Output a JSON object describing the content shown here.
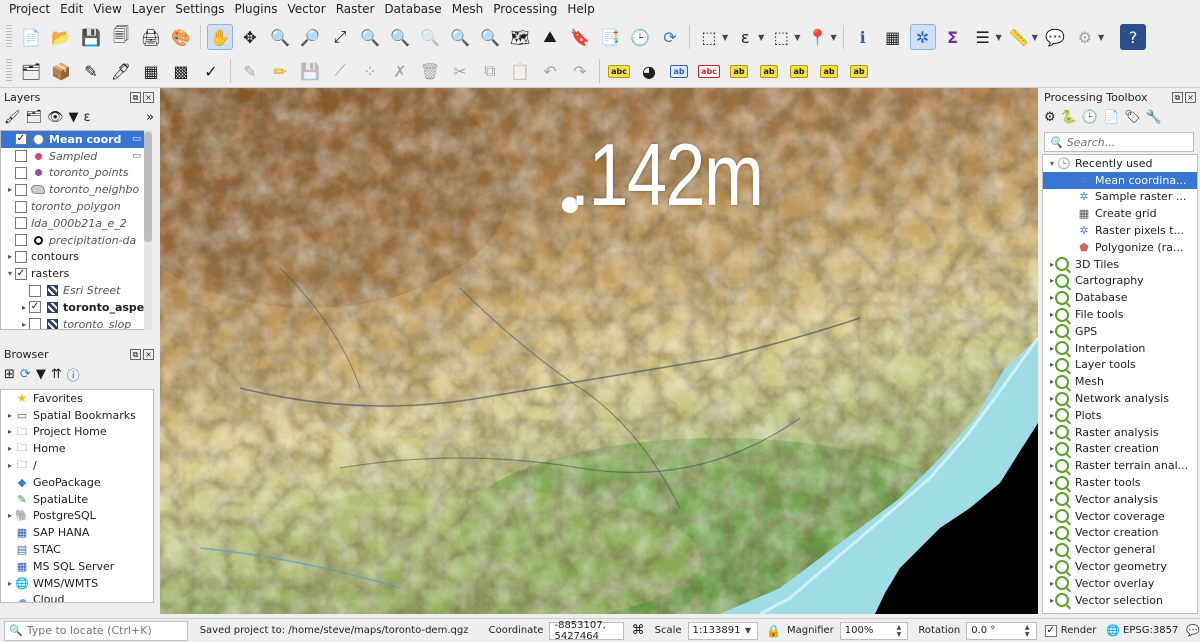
{
  "menu": [
    "Project",
    "Edit",
    "View",
    "Layer",
    "Settings",
    "Plugins",
    "Vector",
    "Raster",
    "Database",
    "Mesh",
    "Processing",
    "Help"
  ],
  "layers_panel": {
    "title": "Layers",
    "items": [
      {
        "label": "Mean coord",
        "checked": true,
        "selected": true,
        "style": "bold",
        "symbol": "circle-white-icon",
        "expander": "",
        "indent": 0
      },
      {
        "label": "Sampled",
        "checked": false,
        "style": "italic",
        "symbol": "dot-pink-icon",
        "expander": "",
        "indent": 0
      },
      {
        "label": "toronto_points",
        "checked": false,
        "style": "italic",
        "symbol": "dot-purple-icon",
        "expander": "",
        "indent": 0
      },
      {
        "label": "toronto_neighbo",
        "checked": false,
        "style": "italic",
        "symbol": "polygon-grey-icon",
        "expander": "▸",
        "indent": 0
      },
      {
        "label": "toronto_polygon",
        "checked": false,
        "style": "italic",
        "symbol": "",
        "expander": "",
        "indent": 0
      },
      {
        "label": "lda_000b21a_e_2",
        "checked": false,
        "style": "italic",
        "symbol": "",
        "expander": "",
        "indent": 0
      },
      {
        "label": "precipitation-da",
        "checked": false,
        "style": "italic",
        "symbol": "ring-black-icon",
        "expander": "",
        "indent": 0
      },
      {
        "label": "contours",
        "checked": false,
        "style": "normal",
        "symbol": "",
        "expander": "▸",
        "indent": 0
      },
      {
        "label": "rasters",
        "checked": true,
        "style": "normal",
        "symbol": "",
        "expander": "▾",
        "indent": 0
      },
      {
        "label": "Esri Street",
        "checked": false,
        "style": "italic",
        "symbol": "raster-icon",
        "expander": "",
        "indent": 1
      },
      {
        "label": "toronto_aspe",
        "checked": true,
        "style": "bold",
        "symbol": "raster-icon",
        "expander": "▸",
        "indent": 1
      },
      {
        "label": "toronto_slop",
        "checked": false,
        "style": "italic",
        "symbol": "raster-icon",
        "expander": "▸",
        "indent": 1
      }
    ]
  },
  "browser_panel": {
    "title": "Browser",
    "items": [
      {
        "label": "Favorites",
        "icon": "star-icon",
        "expander": ""
      },
      {
        "label": "Spatial Bookmarks",
        "icon": "bookmark-icon",
        "expander": "▸"
      },
      {
        "label": "Project Home",
        "icon": "folder-icon",
        "expander": "▸"
      },
      {
        "label": "Home",
        "icon": "folder-icon",
        "expander": "▸"
      },
      {
        "label": "/",
        "icon": "folder-icon",
        "expander": "▸"
      },
      {
        "label": "GeoPackage",
        "icon": "geopackage-icon",
        "expander": ""
      },
      {
        "label": "SpatiaLite",
        "icon": "spatialite-icon",
        "expander": ""
      },
      {
        "label": "PostgreSQL",
        "icon": "postgresql-icon",
        "expander": "▸"
      },
      {
        "label": "SAP HANA",
        "icon": "database-icon",
        "expander": ""
      },
      {
        "label": "STAC",
        "icon": "stac-icon",
        "expander": ""
      },
      {
        "label": "MS SQL Server",
        "icon": "database-icon",
        "expander": ""
      },
      {
        "label": "WMS/WMTS",
        "icon": "globe-icon",
        "expander": "▸"
      },
      {
        "label": "Cloud",
        "icon": "cloud-icon",
        "expander": ""
      }
    ]
  },
  "map": {
    "scale_text": ".142m"
  },
  "processing": {
    "title": "Processing Toolbox",
    "search_placeholder": "Search...",
    "recently_used": {
      "label": "Recently used",
      "items": [
        {
          "label": "Mean coordina...",
          "selected": true,
          "icon": "gear-icon"
        },
        {
          "label": "Sample raster ...",
          "selected": false,
          "icon": "gear-icon"
        },
        {
          "label": "Create grid",
          "selected": false,
          "icon": "grid-icon"
        },
        {
          "label": "Raster pixels t...",
          "selected": false,
          "icon": "gear-icon"
        },
        {
          "label": "Polygonize (ra...",
          "selected": false,
          "icon": "polygon-icon"
        }
      ]
    },
    "groups": [
      "3D Tiles",
      "Cartography",
      "Database",
      "File tools",
      "GPS",
      "Interpolation",
      "Layer tools",
      "Mesh",
      "Network analysis",
      "Plots",
      "Raster analysis",
      "Raster creation",
      "Raster terrain anal...",
      "Raster tools",
      "Vector analysis",
      "Vector coverage",
      "Vector creation",
      "Vector general",
      "Vector geometry",
      "Vector overlay",
      "Vector selection"
    ]
  },
  "status": {
    "locate_placeholder": "Type to locate (Ctrl+K)",
    "message": "Saved project to: /home/steve/maps/toronto-dem.qgz",
    "coordinate_label": "Coordinate",
    "coordinate_value": "-8853107, 5427464",
    "scale_label": "Scale",
    "scale_value": "1:133891",
    "magnifier_label": "Magnifier",
    "magnifier_value": "100%",
    "rotation_label": "Rotation",
    "rotation_value": "0.0 °",
    "render_label": "Render",
    "epsg": "EPSG:3857"
  }
}
